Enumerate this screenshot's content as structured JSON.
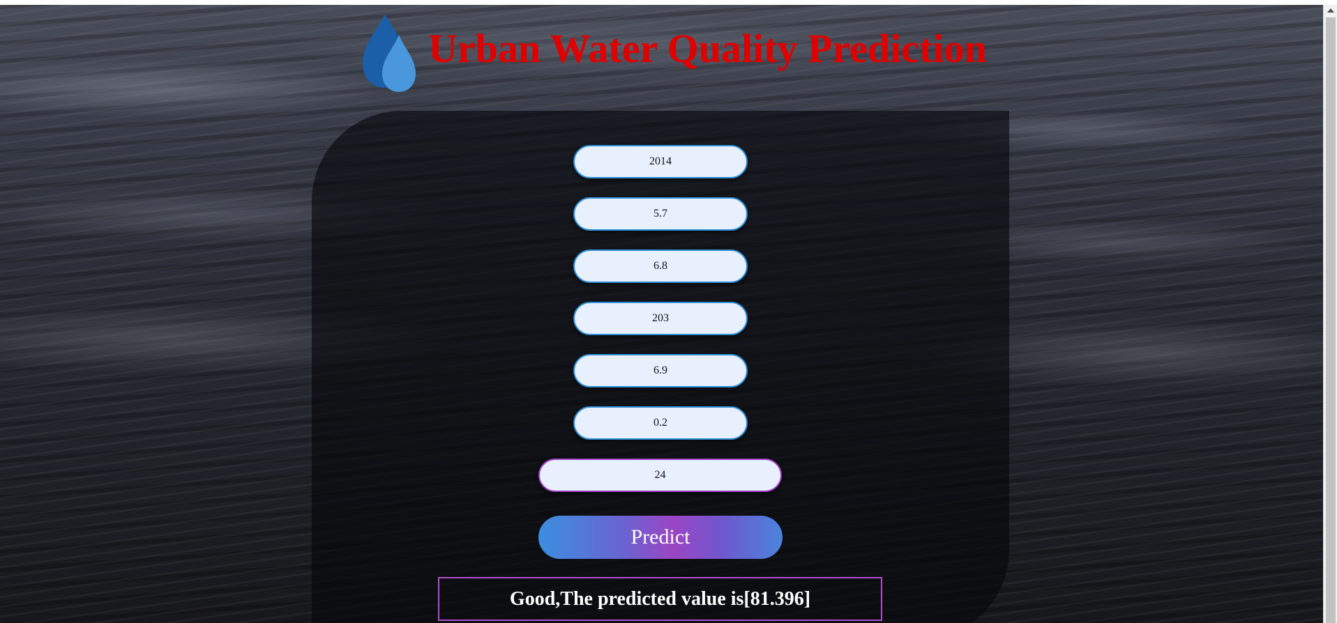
{
  "header": {
    "title": "Urban Water Quality Prediction",
    "icon": "water-drops-icon"
  },
  "form": {
    "fields": [
      {
        "value": "2014"
      },
      {
        "value": "5.7"
      },
      {
        "value": "6.8"
      },
      {
        "value": "203"
      },
      {
        "value": "6.9"
      },
      {
        "value": "0.2"
      },
      {
        "value": "24"
      }
    ],
    "submit_label": "Predict"
  },
  "result": {
    "text": "Good,The predicted value is[81.396]"
  },
  "colors": {
    "title": "#e00000",
    "field_border": "#2d8fd6",
    "field_border_active": "#a13fc1",
    "field_fill": "#e8f0fe",
    "result_border": "#b04fd0"
  }
}
